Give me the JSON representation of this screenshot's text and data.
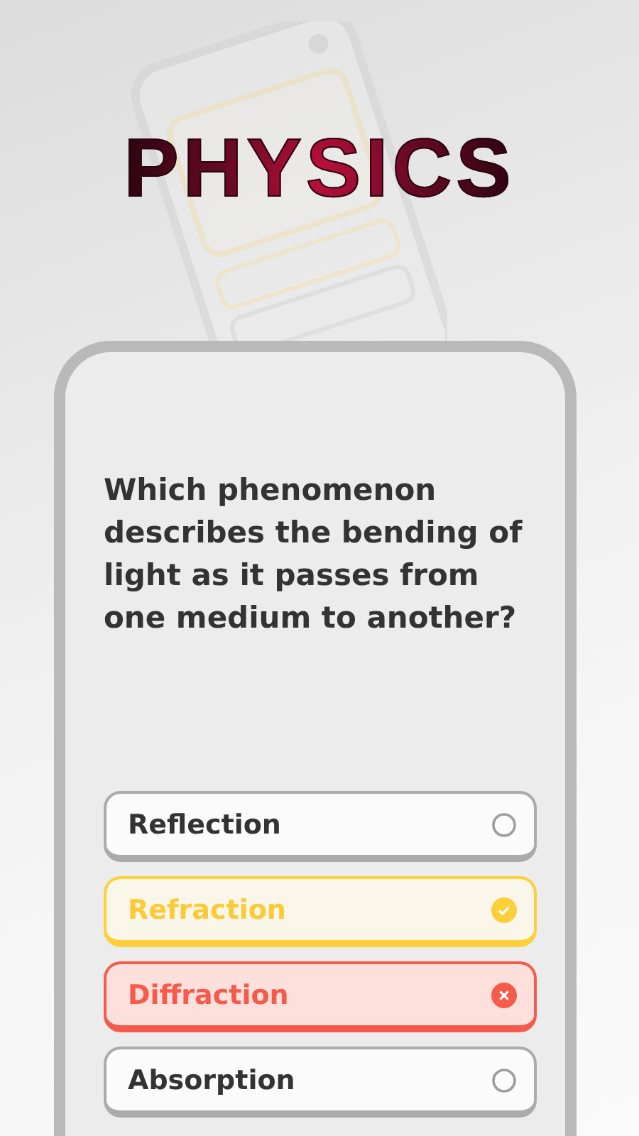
{
  "title": "PHYSICS",
  "question": "Which phenomenon describes the bending of light as it passes from one medium to another?",
  "options": [
    {
      "label": "Reflection",
      "kind": "neutral"
    },
    {
      "label": "Refraction",
      "kind": "correct"
    },
    {
      "label": "Diffraction",
      "kind": "wrong"
    },
    {
      "label": "Absorption",
      "kind": "neutral"
    }
  ]
}
